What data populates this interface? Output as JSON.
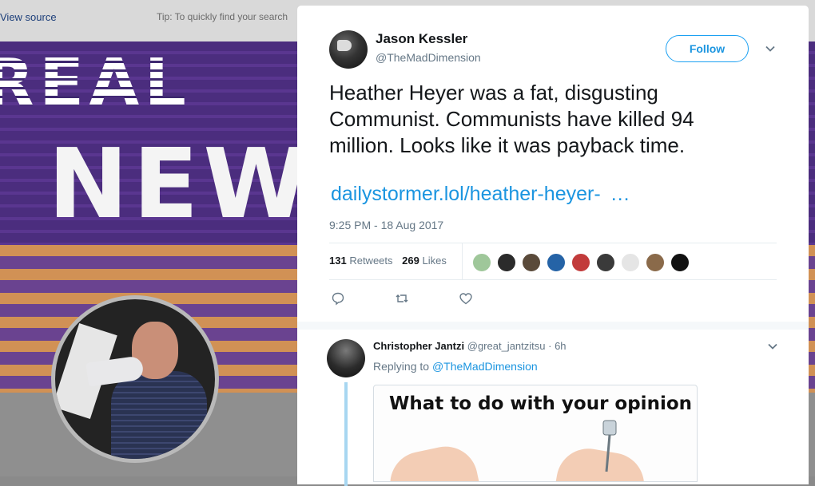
{
  "background_page": {
    "view_source_link": "View source",
    "tip_text": "Tip: To quickly find your search"
  },
  "tweet": {
    "author": {
      "name": "Jason Kessler",
      "handle": "@TheMadDimension"
    },
    "follow_label": "Follow",
    "text": "Heather Heyer was a fat, disgusting Communist. Communists have killed 94 million. Looks like it was payback time.",
    "link_text": "dailystormer.lol/heather-heyer-",
    "link_ellipsis": "…",
    "timestamp": "9:25 PM - 18 Aug 2017",
    "stats": {
      "retweets_count": "131",
      "retweets_label": "Retweets",
      "likes_count": "269",
      "likes_label": "Likes"
    },
    "liker_avatar_colors": [
      "#9fc79a",
      "#2b2b2b",
      "#5a4a3a",
      "#2563a6",
      "#c23b3b",
      "#3a3a3a",
      "#e5e5e5",
      "#8a6a4a",
      "#111111"
    ]
  },
  "reply": {
    "name": "Christopher Jantzi",
    "handle": "@great_jantzitsu",
    "time": "· 6h",
    "replying_to_label": "Replying to",
    "replying_to_handle": "@TheMadDimension",
    "image_caption": "What to do with your opinion"
  },
  "colors": {
    "twitter_blue": "#1b95e0",
    "reply_thread_line": "#a7d6f1"
  }
}
